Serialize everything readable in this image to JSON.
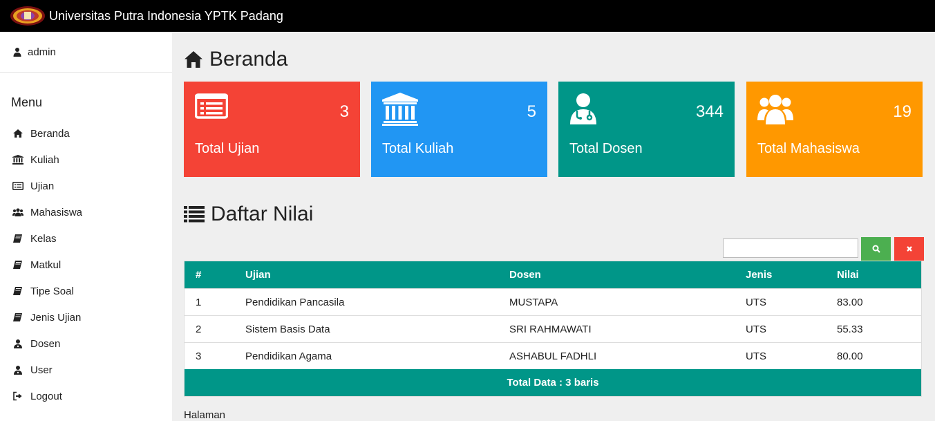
{
  "header": {
    "title": "Universitas Putra Indonesia YPTK Padang",
    "logo_icon": "university-logo-icon"
  },
  "sidebar": {
    "user": "admin",
    "menu_title": "Menu",
    "items": [
      {
        "label": "Beranda",
        "icon": "home-icon"
      },
      {
        "label": "Kuliah",
        "icon": "university-icon"
      },
      {
        "label": "Ujian",
        "icon": "list-card-icon"
      },
      {
        "label": "Mahasiswa",
        "icon": "users-icon"
      },
      {
        "label": "Kelas",
        "icon": "book-icon"
      },
      {
        "label": "Matkul",
        "icon": "book-icon"
      },
      {
        "label": "Tipe Soal",
        "icon": "book-icon"
      },
      {
        "label": "Jenis Ujian",
        "icon": "book-icon"
      },
      {
        "label": "Dosen",
        "icon": "user-doctor-icon"
      },
      {
        "label": "User",
        "icon": "user-doctor-icon"
      },
      {
        "label": "Logout",
        "icon": "sign-out-icon"
      }
    ]
  },
  "main": {
    "title": "Beranda",
    "cards": [
      {
        "label": "Total Ujian",
        "value": "3",
        "color": "#f44336",
        "icon": "list-card-icon"
      },
      {
        "label": "Total Kuliah",
        "value": "5",
        "color": "#2196f3",
        "icon": "university-icon"
      },
      {
        "label": "Total Dosen",
        "value": "344",
        "color": "#009688",
        "icon": "user-doctor-icon"
      },
      {
        "label": "Total Mahasiswa",
        "value": "19",
        "color": "#ff9800",
        "icon": "users-icon"
      }
    ],
    "list_title": "Daftar Nilai",
    "search": {
      "value": "",
      "placeholder": ""
    },
    "table": {
      "headers": [
        "#",
        "Ujian",
        "Dosen",
        "Jenis",
        "Nilai"
      ],
      "rows": [
        [
          "1",
          "Pendidikan Pancasila",
          "MUSTAPA",
          "UTS",
          "83.00"
        ],
        [
          "2",
          "Sistem Basis Data",
          "SRI RAHMAWATI",
          "UTS",
          "55.33"
        ],
        [
          "3",
          "Pendidikan Agama",
          "ASHABUL FADHLI",
          "UTS",
          "80.00"
        ]
      ],
      "footer": "Total Data : 3 baris"
    },
    "pagination_label": "Halaman"
  },
  "colors": {
    "topbar": "#000000",
    "accent": "#009688",
    "search_button": "#4caf50",
    "clear_button": "#f44336"
  }
}
